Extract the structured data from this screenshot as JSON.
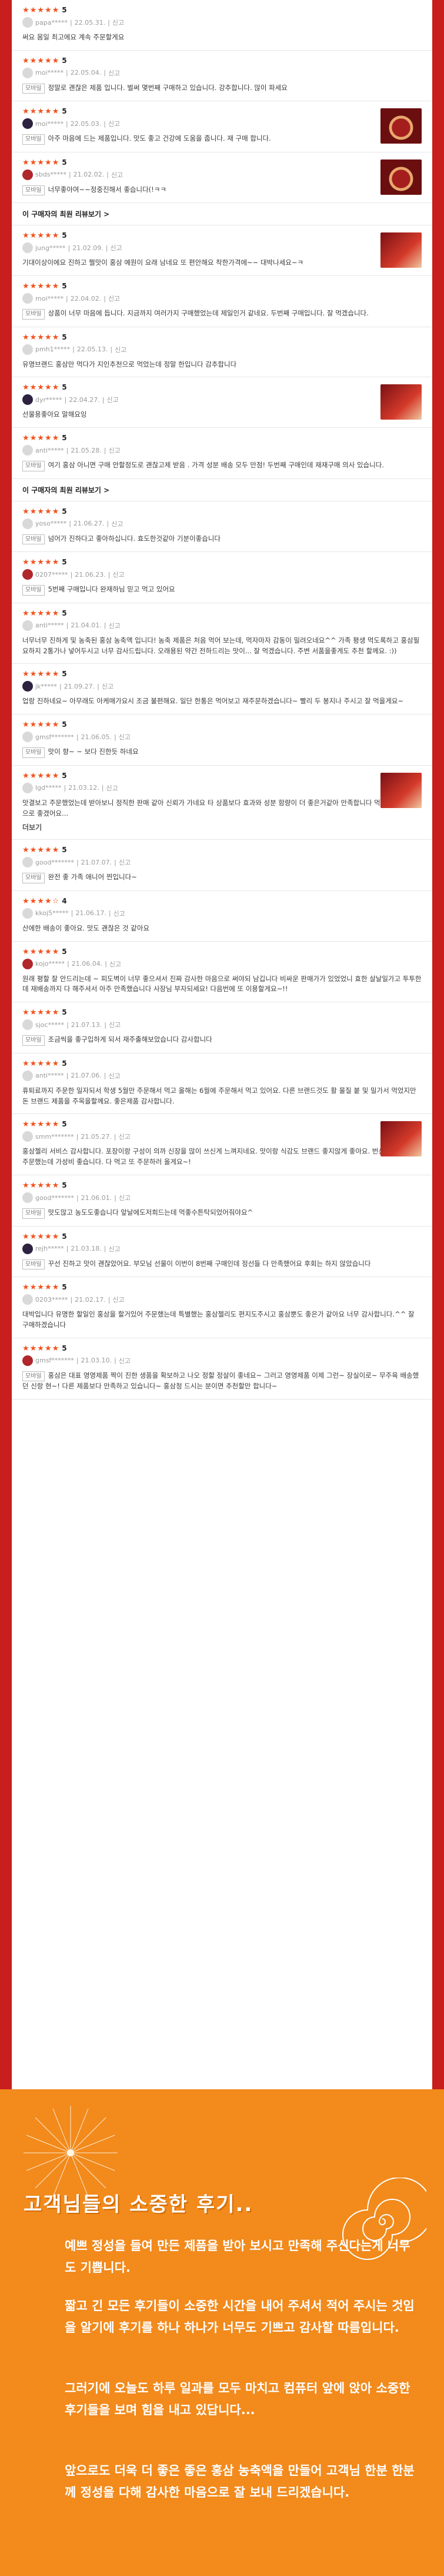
{
  "reviews": [
    {
      "score": "5",
      "user": "papa*****",
      "date": "22.05.31.",
      "report": "신고",
      "text": "써요 몸일 최고에요 계속 주문할게요",
      "photo": false
    },
    {
      "score": "5",
      "user": "moi*****",
      "date": "22.05.04.",
      "report": "신고",
      "option": "모바일",
      "text": "정말로 괜찮은 제품 입니다. 벌써 몇번째 구매하고 있습니다. 강추합니다. 많이 파세요",
      "photo": false
    },
    {
      "score": "5",
      "user": "moi*****",
      "date": "22.05.03.",
      "report": "신고",
      "option": "모바일",
      "text": "아주 마음에 드는 제품입니다. 맛도 좋고 건강에 도움을 줍니다. 재 구매 합니다.",
      "photo": "jar"
    },
    {
      "score": "5",
      "user": "sbds*****",
      "date": "21.02.02.",
      "report": "신고",
      "option": "모바일",
      "text": "너무좋아여~~정중진해서 좋습니다(!ㅋㅋ",
      "photo": "jar"
    },
    {
      "score": "5",
      "user": "jung*****",
      "date": "21.02.09.",
      "report": "신고",
      "text": "기대이상이에요 진하고 쩔맛이 홍삼 예원이 요래 남네요  또 편안해요 착한가격에~~ 대박나세요~ㅋ",
      "photo": true
    },
    {
      "score": "5",
      "user": "moi*****",
      "date": "22.04.02.",
      "report": "신고",
      "option": "모바일",
      "text": "상품이 너무 마음에 듭니다. 지금까지 여러가지 구매했었는데 제일인거 같네요. 두번째 구매입니다. 잘 먹겠습니다.",
      "photo": false
    },
    {
      "score": "5",
      "user": "pmh1*****",
      "date": "22.05.13.",
      "report": "신고",
      "text": "유명브랜드 홍삼만 먹다가 지인추천으로 먹었는데 정말 한입니다 감추합니다",
      "photo": false
    },
    {
      "score": "5",
      "user": "dyr*****",
      "date": "22.04.27.",
      "report": "신고",
      "text": "선물용좋아요 말해요잉",
      "photo": true
    },
    {
      "score": "5",
      "user": "anti*****",
      "date": "21.05.28.",
      "report": "신고",
      "option": "모바일",
      "text": "여기 홍삼 아니면 구매 안할정도로 괜찮고제 받음 . 가격 성분 배송 모두 만점! 두번째 구매인데 재재구매 의사 있습니다.",
      "photo": false
    },
    {
      "score": "5",
      "user": "yoso*****",
      "date": "21.06.27.",
      "report": "신고",
      "option": "모바일",
      "text": "넘어가 진하다고 좋아하십니다. 효도한것같아 기분이좋습니다",
      "photo": false
    },
    {
      "score": "5",
      "user": "0207*****",
      "date": "21.06.23.",
      "report": "신고",
      "option": "모바일",
      "text": "5번째 구매입니다 완재하님 믿고 먹고 있어요",
      "photo": false
    },
    {
      "score": "5",
      "user": "anti*****",
      "date": "21.04.01.",
      "report": "신고",
      "text": "너무너무 진하게 및 농축된 홍삼 농축액 입니다! 농축 제품은 처음 먹어 보는데, 먹자마자 감동이 밀려오네요^^ 가족 평생 먹도록하고 홍삼필요하지 2통가나 넣어두시고 너무 감사드립니다. 오래용된 약간 전하드리는 맛이... 잘 먹겠습니다. 주변 서품을좋게도 추천 할께요. :))",
      "photo": false
    },
    {
      "score": "5",
      "user": "jk*****",
      "date": "21.09.27.",
      "report": "신고",
      "text": "업랑 진하네요~ 아무래도 아케매가요시 조금 불편해요. 일단 한통은 먹어보고 재주문하겠습니다~ 빨리 두 봉지나 주시고 잘 먹을게요~",
      "photo": false
    },
    {
      "score": "5",
      "user": "gmsf*******",
      "date": "21.06.05.",
      "report": "신고",
      "option": "모바일",
      "text": "맛이 향~ ~ 보다 진한듯 하네요",
      "photo": false
    },
    {
      "score": "5",
      "user": "lgd*****",
      "date": "21.03.12.",
      "report": "신고",
      "text": "맛결보고 주문했었는데 받아보니 정직한 판매 같아 신뢰가 가네요 타 상품보다 효과와 성분 함량이 더 좋은거같아 만족합니다 먹고 있는 제 정으로 좋겠어요...",
      "photo": true,
      "more": "더보기"
    },
    {
      "score": "5",
      "user": "good*******",
      "date": "21.07.07.",
      "report": "신고",
      "option": "모바일",
      "text": "완전 좋 가족 애니어 찐입니다~",
      "photo": false
    },
    {
      "score": "4",
      "user": "kkoj5*****",
      "date": "21.06.17.",
      "report": "신고",
      "text": "산에한 배송이 좋아요. 맛도 괜찮은 것 같아요",
      "photo": false
    },
    {
      "score": "5",
      "user": "kojo*****",
      "date": "21.06.04.",
      "report": "신고",
      "text": "원래 평할 잘 안드리는데 ~ 피도벽이 너무 좋으셔서 진짜 감사한 마음으로 써야되 남깁니다 비싸운 판매가가 있었었니 효한 살날일가고 투투한데 재배송까지 다 해주셔서 아주 만족했습니다 사장님 부자되세요! 다음번에 또 이용할게요~!!",
      "photo": false
    },
    {
      "score": "5",
      "user": "sjoc*****",
      "date": "21.07.13.",
      "report": "신고",
      "option": "모바일",
      "text": "조금씩을 좋구입하게 되서 재주출해보았습니다 감사합니다",
      "photo": false
    },
    {
      "score": "5",
      "user": "anti*****",
      "date": "21.07.06.",
      "report": "신고",
      "text": "휴퇴료까지 주문한 일자되서 학생 5월만 주문해서 먹고 올해는 6월에 주문해서 먹고 있어요. 다른 브랜드것도 활 물질 붙 및 밀가서 먹었지만 돈 브랜드 제품을 주목을할께요. 좋은제품 감사합니다.",
      "photo": false
    },
    {
      "score": "5",
      "user": "smm*******",
      "date": "21.05.27.",
      "report": "신고",
      "text": "홍삼젤리 서비스 감사합니다. 포장이랑 구성이 의까 신장을 많이 쓰신게 느껴지네요. 맛이랑 식감도 브랜드 좋지않게 좋아요. 번산판매까해서 주문했는데 가성비 좋습니다. 다 먹고 또 주문하러 올게요~!",
      "photo": true
    },
    {
      "score": "5",
      "user": "good*******",
      "date": "21.06.01.",
      "report": "신고",
      "option": "모바일",
      "text": "맛도많고 농도도좋습니다 앞날에도저희드는데 먹좋수튼탁되었어줘야요^",
      "photo": false
    },
    {
      "score": "5",
      "user": "rejh*****",
      "date": "21.03.18.",
      "report": "신고",
      "option": "모바일",
      "text": "꾸선 진하고 맛이 괜찮았어요. 부모님 선물이 이번이 8번째 구매인데 정선들 다 만족했어요 후회는 하지 않았습니다",
      "photo": false
    },
    {
      "score": "5",
      "user": "0203*****",
      "date": "21.02.17.",
      "report": "신고",
      "text": "대박입니다 유명한 할일인 홍삼을 할거있어 주문했는데 특별했는 홍삼젤리도 편지도주시고 홍삼뿐도 좋은가 같아요 너무 감사합니다.^^ 잘 구매하겠습니다",
      "photo": false
    },
    {
      "score": "5",
      "user": "gmsf*******",
      "date": "21.03.10.",
      "report": "신고",
      "option": "모바일",
      "text": "홍삼은 대표 영영제품 짝이 진한 생품을 확보하고 나오 정할 정살이 좋네요~ 그러고 영영제품 이제 그런~ 장실이로~ 무주육 배송했던 신랑 현~! 다른 제품보다 만족하고 있습니다~ 홍삼청 드시는 분이면 추천할만 합니다~",
      "photo": false
    }
  ],
  "section_links": [
    "이 구매자의 최원 리뷰보기 >",
    "이 구매자의 최원 리뷰보기 >"
  ],
  "thanks": {
    "title": "고객님들의 소중한 후기..",
    "p1": "예쁘 정성을 들여 만든 제품을 받아 보시고 만족해 주신다는게 너무도 기쁩니다.",
    "p2": "짧고 긴 모든 후기들이 소중한 시간을 내어 주셔서 적어 주시는 것임을 알기에 후기를 하나 하나가 너무도 기쁘고 감사할 따름입니다.",
    "p3": "그러기에 오늘도 하루 일과를 모두 마치고 컴퓨터 앞에 앉아 소중한 후기들을 보며 힘을 내고 있답니다...",
    "p4": "앞으로도 더욱 더 좋은 좋은 홍삼 농축액을 만들어 고객님 한분 한분께 정성을 다해 감사한 마음으로 잘 보내 드리겠습니다."
  }
}
